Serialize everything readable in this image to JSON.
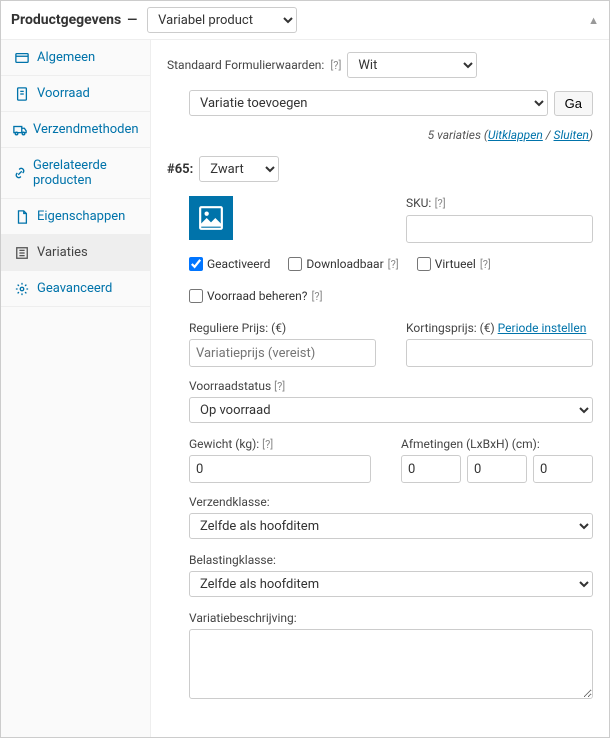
{
  "header": {
    "title": "Productgegevens",
    "dash": "—",
    "product_type": "Variabel product"
  },
  "sidebar": {
    "items": [
      {
        "label": "Algemeen"
      },
      {
        "label": "Voorraad"
      },
      {
        "label": "Verzendmethoden"
      },
      {
        "label": "Gerelateerde producten"
      },
      {
        "label": "Eigenschappen"
      },
      {
        "label": "Variaties"
      },
      {
        "label": "Geavanceerd"
      }
    ]
  },
  "main": {
    "default_form_label": "Standaard Formulierwaarden:",
    "default_form_value": "Wit",
    "add_variation_option": "Variatie toevoegen",
    "go": "Ga",
    "summary_count": "5 variaties",
    "summary_open": "(",
    "expand": "Uitklappen",
    "summary_sep": " / ",
    "collapse": "Sluiten",
    "summary_close": ")",
    "variation": {
      "id": "#65:",
      "attr_value": "Zwart",
      "sku_label": "SKU:",
      "sku_value": "",
      "checks": {
        "activated": "Geactiveerd",
        "downloadable": "Downloadbaar",
        "virtual": "Virtueel",
        "manage_stock": "Voorraad beheren?"
      },
      "regular_price_label": "Reguliere Prijs: (€)",
      "regular_price_placeholder": "Variatieprijs (vereist)",
      "sale_price_label": "Kortingsprijs: (€)",
      "schedule_link": "Periode instellen",
      "stock_status_label": "Voorraadstatus",
      "stock_status_value": "Op voorraad",
      "weight_label": "Gewicht (kg):",
      "weight_value": "0",
      "dimensions_label": "Afmetingen (LxBxH) (cm):",
      "dim_l": "0",
      "dim_b": "0",
      "dim_h": "0",
      "shipping_class_label": "Verzendklasse:",
      "shipping_class_value": "Zelfde als hoofditem",
      "tax_class_label": "Belastingklasse:",
      "tax_class_value": "Zelfde als hoofditem",
      "description_label": "Variatiebeschrijving:",
      "description_value": ""
    },
    "help": "[?]"
  }
}
